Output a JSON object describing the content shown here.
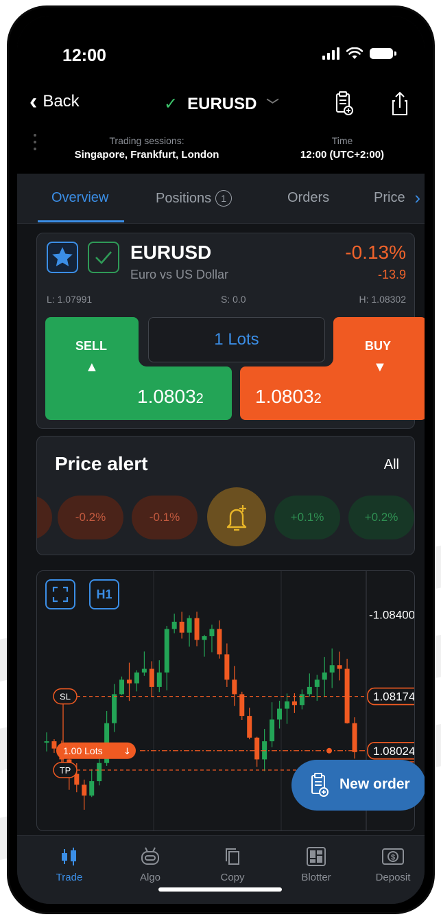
{
  "status_bar": {
    "time": "12:00"
  },
  "nav": {
    "back_label": "Back",
    "symbol": "EURUSD"
  },
  "sessions": {
    "trading_label": "Trading sessions:",
    "trading_value": "Singapore, Frankfurt, London",
    "time_label": "Time",
    "time_value": "12:00 (UTC+2:00)"
  },
  "tabs": [
    {
      "label": "Overview",
      "active": true
    },
    {
      "label": "Positions",
      "badge": "1"
    },
    {
      "label": "Orders"
    },
    {
      "label": "Price"
    }
  ],
  "instrument": {
    "symbol": "EURUSD",
    "description": "Euro vs US Dollar",
    "change_pct": "-0.13%",
    "change_points": "-13.9",
    "low": "L: 1.07991",
    "spread": "S: 0.0",
    "high": "H: 1.08302",
    "sell_label": "SELL",
    "buy_label": "BUY",
    "lots": "1 Lots",
    "sell_price": "1.0803",
    "sell_price_sub": "2",
    "buy_price": "1.0803",
    "buy_price_sub": "2"
  },
  "price_alert": {
    "title": "Price alert",
    "all_label": "All",
    "pills": [
      "-0.2%",
      "-0.1%",
      "+0.1%",
      "+0.2%"
    ]
  },
  "chart": {
    "timeframe": "H1",
    "price_labels": [
      "-1.08400",
      "1.08174",
      "1.08024"
    ],
    "sl_label": "SL",
    "tp_label": "TP",
    "lots_label": "1.00 Lots"
  },
  "chart_data": {
    "type": "candlestick",
    "y_ticks": [
      1.084
    ],
    "markers": {
      "sl": 1.08174,
      "current": 1.08024
    }
  },
  "new_order_label": "New order",
  "bottom_nav": [
    {
      "label": "Trade",
      "icon": "candles-icon",
      "active": true
    },
    {
      "label": "Algo",
      "icon": "robot-icon"
    },
    {
      "label": "Copy",
      "icon": "copy-icon"
    },
    {
      "label": "Blotter",
      "icon": "blotter-icon"
    },
    {
      "label": "Deposit",
      "icon": "deposit-icon"
    }
  ],
  "colors": {
    "accent": "#3b8ee6",
    "sell": "#23a456",
    "buy": "#f05a22",
    "negative": "#f0632b"
  }
}
